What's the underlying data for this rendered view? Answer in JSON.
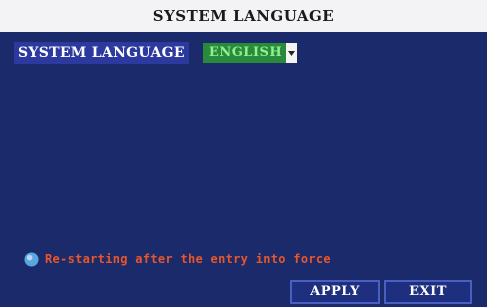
{
  "window": {
    "title": "SYSTEM LANGUAGE"
  },
  "setting": {
    "label": "SYSTEM LANGUAGE",
    "selected_value": "ENGLISH"
  },
  "notice": {
    "text": "Re-starting after the entry into force",
    "icon": "info-icon"
  },
  "buttons": {
    "apply_label": "APPLY",
    "exit_label": "EXIT"
  },
  "colors": {
    "background": "#1a2a6b",
    "dropdown_bg": "#2a8a3c",
    "dropdown_text": "#8ef28e",
    "notice_text": "#e8562a"
  }
}
